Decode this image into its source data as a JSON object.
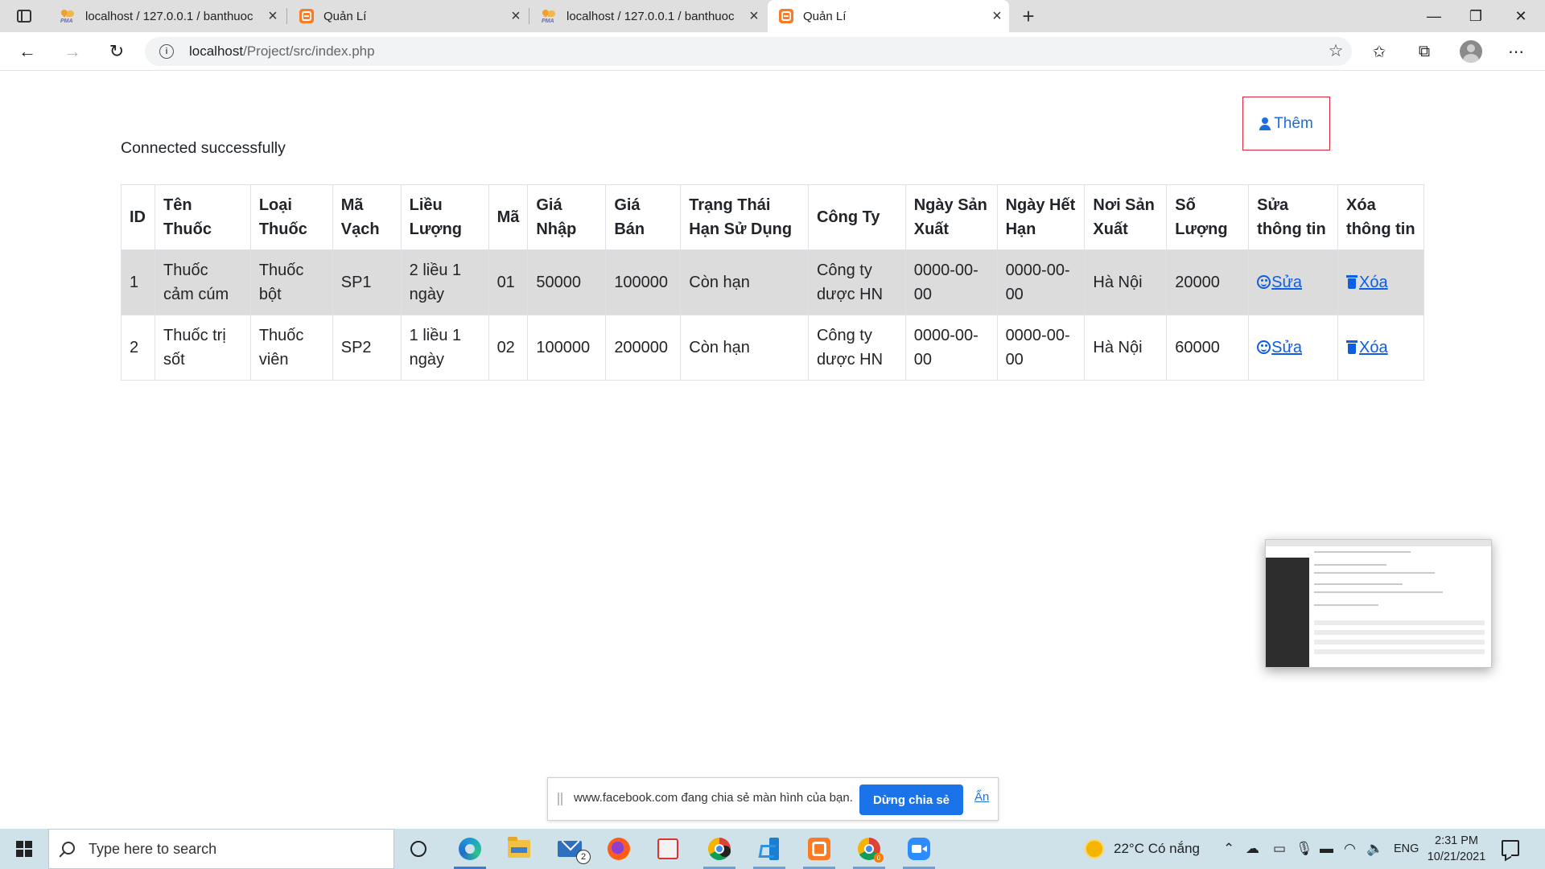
{
  "browser": {
    "tabs": [
      {
        "title": "localhost / 127.0.0.1 / banthuoc",
        "favicon": "phpmyadmin-icon",
        "favicon_text": "PMA",
        "active": false
      },
      {
        "title": "Quản Lí",
        "favicon": "xampp-icon",
        "active": false
      },
      {
        "title": "localhost / 127.0.0.1 / banthuoc",
        "favicon": "phpmyadmin-icon",
        "favicon_text": "PMA",
        "active": false
      },
      {
        "title": "Quản Lí",
        "favicon": "xampp-icon",
        "active": true
      }
    ],
    "url_host": "localhost",
    "url_path": "/Project/src/index.php"
  },
  "page": {
    "add_button_label": "Thêm",
    "status_text": "Connected successfully",
    "table": {
      "headers": [
        "ID",
        "Tên Thuốc",
        "Loại Thuốc",
        "Mã Vạch",
        "Liều Lượng",
        "Mã",
        "Giá Nhập",
        "Giá Bán",
        "Trạng Thái Hạn Sử Dụng",
        "Công Ty",
        "Ngày Sản Xuất",
        "Ngày Hết Hạn",
        "Nơi Sản Xuất",
        "Số Lượng",
        "Sửa thông tin",
        "Xóa thông tin"
      ],
      "rows": [
        {
          "cells": [
            "1",
            "Thuốc cảm cúm",
            "Thuốc bột",
            "SP1",
            "2 liều 1 ngày",
            "01",
            "50000",
            "100000",
            "Còn hạn",
            "Công ty dược HN",
            "0000-00-00",
            "0000-00-00",
            "Hà Nội",
            "20000"
          ],
          "edit_label": "Sửa",
          "delete_label": "Xóa"
        },
        {
          "cells": [
            "2",
            "Thuốc trị sốt",
            "Thuốc viên",
            "SP2",
            "1 liều 1 ngày",
            "02",
            "100000",
            "200000",
            "Còn hạn",
            "Công ty dược HN",
            "0000-00-00",
            "0000-00-00",
            "Hà Nội",
            "60000"
          ],
          "edit_label": "Sửa",
          "delete_label": "Xóa"
        }
      ]
    }
  },
  "share_bar": {
    "message": "www.facebook.com đang chia sẻ màn hình của bạn.",
    "stop_label": "Dừng chia sẻ",
    "hide_label": "Ẩn"
  },
  "taskbar": {
    "search_placeholder": "Type here to search",
    "mail_badge": "2",
    "chrome_badge": "0",
    "weather": "22°C  Có nắng",
    "language": "ENG",
    "time": "2:31 PM",
    "date": "10/21/2021"
  },
  "colors": {
    "accent": "#1b6de0",
    "add_button_border": "#d9263a",
    "share_button": "#1a73e8",
    "striped_row": "#dcdcdc"
  }
}
